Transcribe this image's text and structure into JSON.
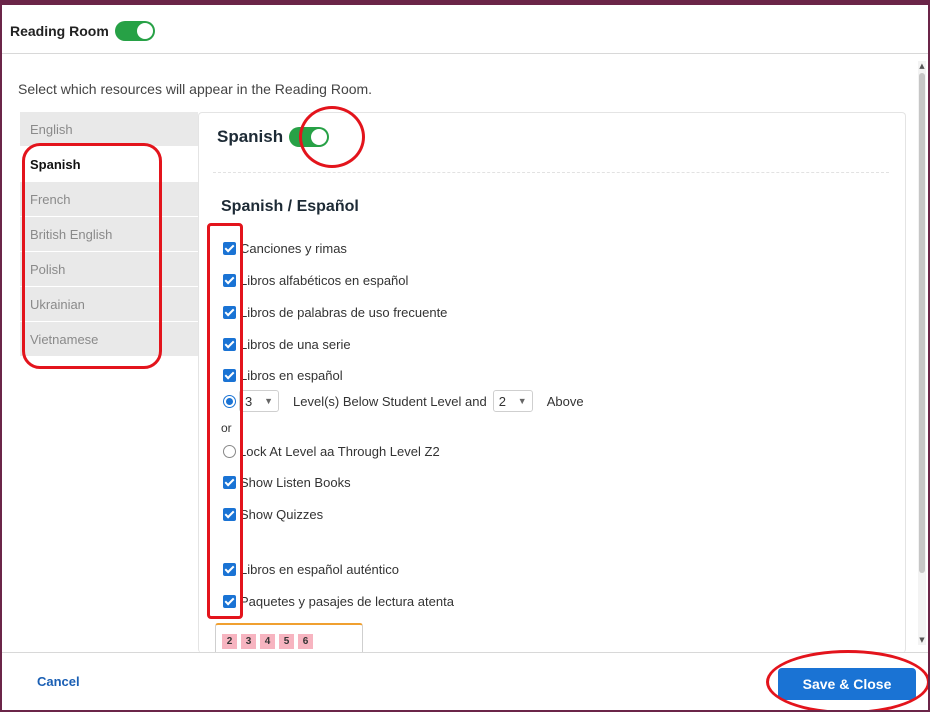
{
  "header": {
    "title": "Reading Room"
  },
  "description": "Select which resources will appear in the Reading Room.",
  "languages": [
    {
      "label": "English",
      "active": false
    },
    {
      "label": "Spanish",
      "active": true
    },
    {
      "label": "French",
      "active": false
    },
    {
      "label": "British English",
      "active": false
    },
    {
      "label": "Polish",
      "active": false
    },
    {
      "label": "Ukrainian",
      "active": false
    },
    {
      "label": "Vietnamese",
      "active": false
    }
  ],
  "panel": {
    "title": "Spanish",
    "section_title": "Spanish / Español",
    "items": {
      "canciones": "Canciones y rimas",
      "alfabeticos": "Libros alfabéticos en español",
      "palabras": "Libros de palabras de uso frecuente",
      "serie": "Libros de una serie",
      "espanol": "Libros en español",
      "listen": "Show Listen Books",
      "quizzes": "Show Quizzes",
      "autentico": "Libros en español auténtico",
      "paquetes": "Paquetes y pasajes de lectura atenta"
    },
    "levels": {
      "below_value": "3",
      "below_label": "Level(s) Below Student Level and",
      "above_value": "2",
      "above_label": "Above",
      "or": "or",
      "lock_label": "Lock At Level aa Through Level Z2"
    },
    "level_chips": [
      "2",
      "3",
      "4",
      "5",
      "6"
    ]
  },
  "footer": {
    "cancel": "Cancel",
    "save": "Save & Close"
  },
  "colors": {
    "accent": "#1a73d4",
    "toggle": "#27a146",
    "frame": "#6b2548",
    "annotation": "#e3141c"
  }
}
